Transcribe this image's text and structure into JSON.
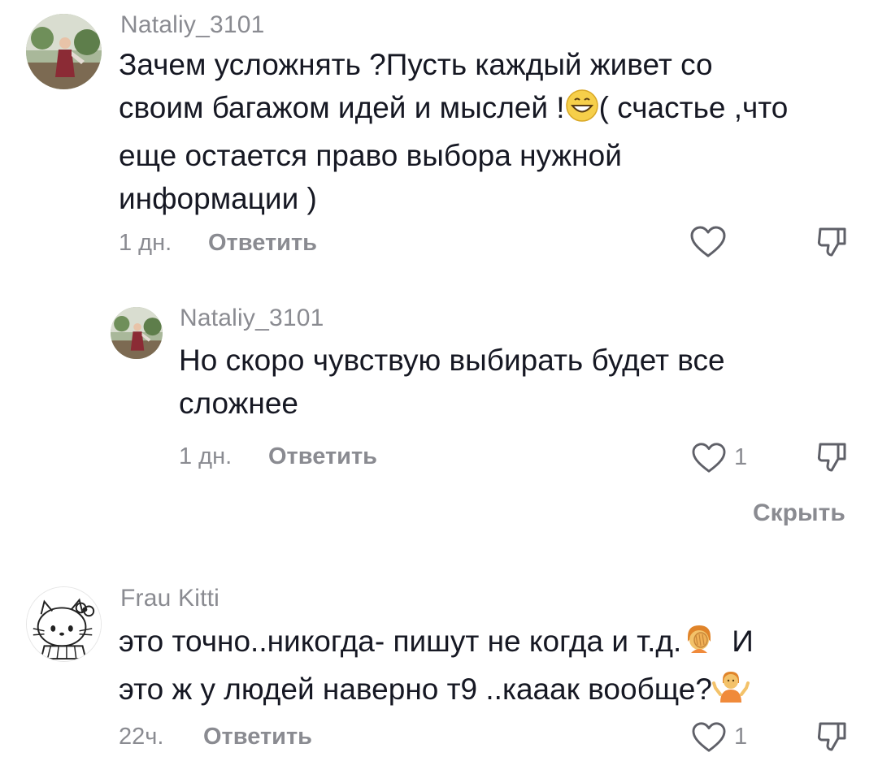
{
  "comments": [
    {
      "username": "Nataliy_3101",
      "text_lines": [
        "Зачем усложнять ?Пусть каждый живет со",
        "своим багажом идей и мыслей !",
        "( счастье ,что",
        "еще остается право выбора нужной",
        "информации )"
      ],
      "time": "1 дн.",
      "reply_label": "Ответить",
      "like_count": ""
    },
    {
      "username": "Nataliy_3101",
      "text_lines": [
        "Но скоро чувствую выбирать будет все",
        "сложнее"
      ],
      "time": "1 дн.",
      "reply_label": "Ответить",
      "like_count": "1"
    },
    {
      "username": "Frau Kitti",
      "text_lines": [
        "это точно..никогда- пишут не когда и т.д.",
        "И",
        "это ж у людей наверно т9 ..кааак вообще?"
      ],
      "time": "22ч.",
      "reply_label": "Ответить",
      "like_count": "1"
    }
  ],
  "hide_replies_label": "Скрыть",
  "icons": {
    "like": "heart-outline-icon",
    "dislike": "thumbs-down-icon",
    "emoji_grin": "grinning-face-emoji",
    "emoji_facepalm": "facepalm-emoji",
    "emoji_shrug": "shrug-emoji"
  },
  "colors": {
    "text": "#161823",
    "muted": "#8a8b91"
  }
}
